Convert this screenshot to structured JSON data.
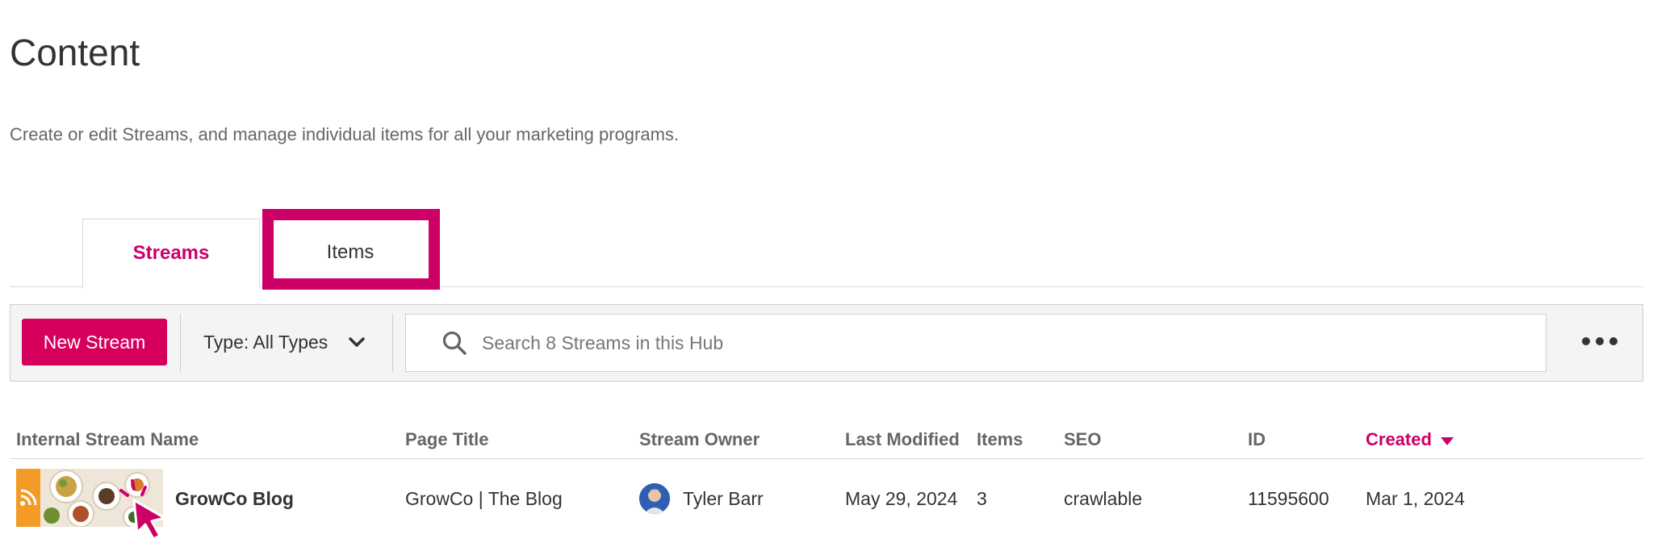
{
  "page": {
    "title": "Content",
    "subtitle": "Create or edit Streams, and manage individual items for all your marketing programs."
  },
  "tabs": [
    {
      "label": "Streams",
      "active": true
    },
    {
      "label": "Items",
      "active": false,
      "highlighted": true
    }
  ],
  "toolbar": {
    "new_stream_label": "New Stream",
    "type_filter_label": "Type: All Types",
    "search_placeholder": "Search 8 Streams in this Hub",
    "more_icon": "ellipsis-icon"
  },
  "table": {
    "columns": [
      "Internal Stream Name",
      "Page Title",
      "Stream Owner",
      "Last Modified",
      "Items",
      "SEO",
      "ID",
      "Created"
    ],
    "sorted_column": "Created",
    "sort_direction": "desc",
    "rows": [
      {
        "internal_name": "GrowCo Blog",
        "page_title": "GrowCo | The Blog",
        "owner": "Tyler Barr",
        "last_modified": "May 29, 2024",
        "items": "3",
        "seo": "crawlable",
        "id": "11595600",
        "created": "Mar 1, 2024"
      }
    ]
  },
  "colors": {
    "accent": "#cc0066",
    "button": "#d6005c",
    "rss_badge": "#f39b26"
  }
}
